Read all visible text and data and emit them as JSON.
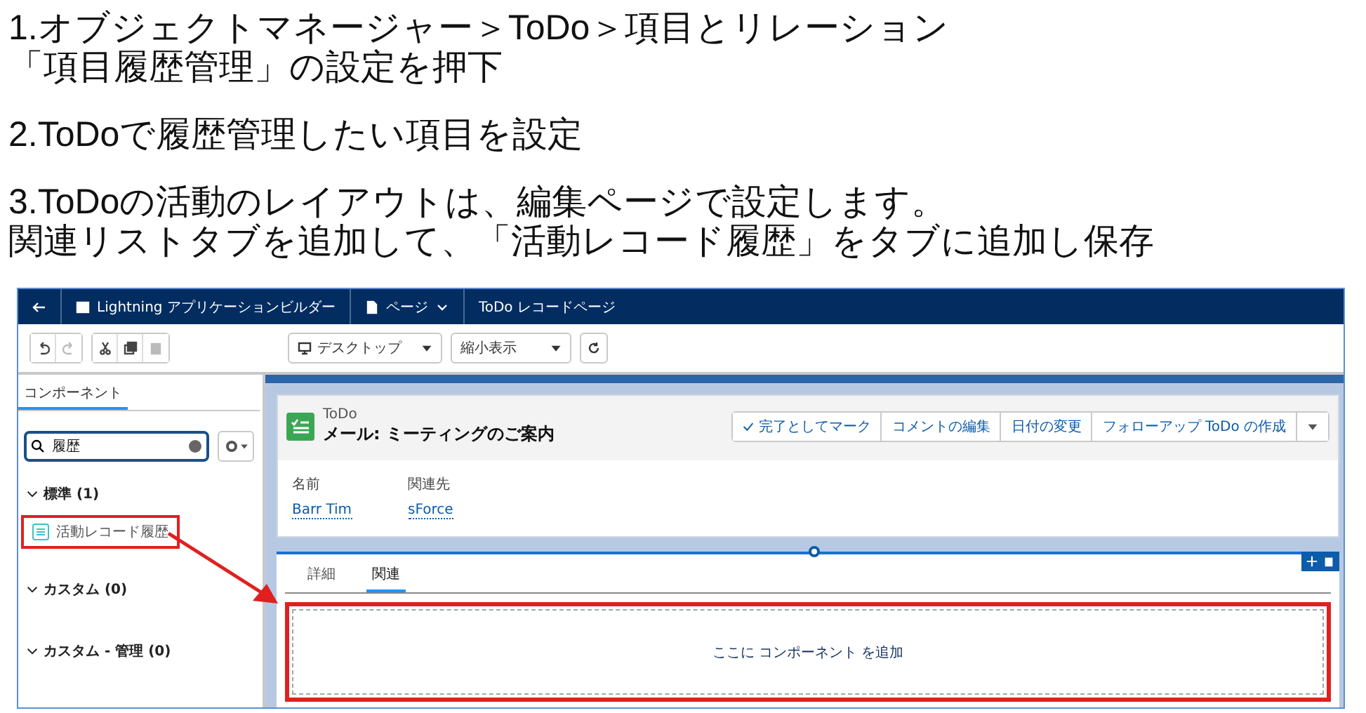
{
  "instructions": [
    {
      "lines": [
        "1.オブジェクトマネージャー＞ToDo＞項目とリレーション",
        "「項目履歴管理」の設定を押下"
      ]
    },
    {
      "lines": [
        "2.ToDoで履歴管理したい項目を設定"
      ]
    },
    {
      "lines": [
        "3.ToDoの活動のレイアウトは、編集ページで設定します。",
        "関連リストタブを追加して、「活動レコード履歴」をタブに追加し保存"
      ]
    }
  ],
  "builder": {
    "header": {
      "app_title": "Lightning アプリケーションビルダー",
      "page_menu": "ページ",
      "page_name": "ToDo レコードページ"
    },
    "toolbar": {
      "device": "デスクトップ",
      "zoom": "縮小表示"
    },
    "sidebar": {
      "tab": "コンポーネント",
      "search_value": "履歴",
      "sections": [
        {
          "title": "標準 (1)",
          "expanded": true,
          "items": [
            {
              "label": "活動レコード履歴",
              "highlighted": true
            }
          ]
        },
        {
          "title": "カスタム (0)",
          "expanded": true
        },
        {
          "title": "カスタム - 管理 (0)",
          "expanded": true
        }
      ]
    },
    "record": {
      "object": "ToDo",
      "title": "メール: ミーティングのご案内",
      "actions": [
        {
          "label": "完了としてマーク",
          "kind": "check"
        },
        {
          "label": "コメントの編集",
          "kind": "plain"
        },
        {
          "label": "日付の変更",
          "kind": "plain"
        },
        {
          "label": "フォローアップ ToDo の作成",
          "kind": "plain"
        }
      ],
      "fields": [
        {
          "label": "名前",
          "value": "Barr Tim"
        },
        {
          "label": "関連先",
          "value": "sForce"
        }
      ]
    },
    "tabs": [
      {
        "label": "詳細",
        "selected": false
      },
      {
        "label": "関連",
        "selected": true
      }
    ],
    "drop_zone": {
      "text": "ここに コンポーネント を追加",
      "highlighted": true
    }
  }
}
